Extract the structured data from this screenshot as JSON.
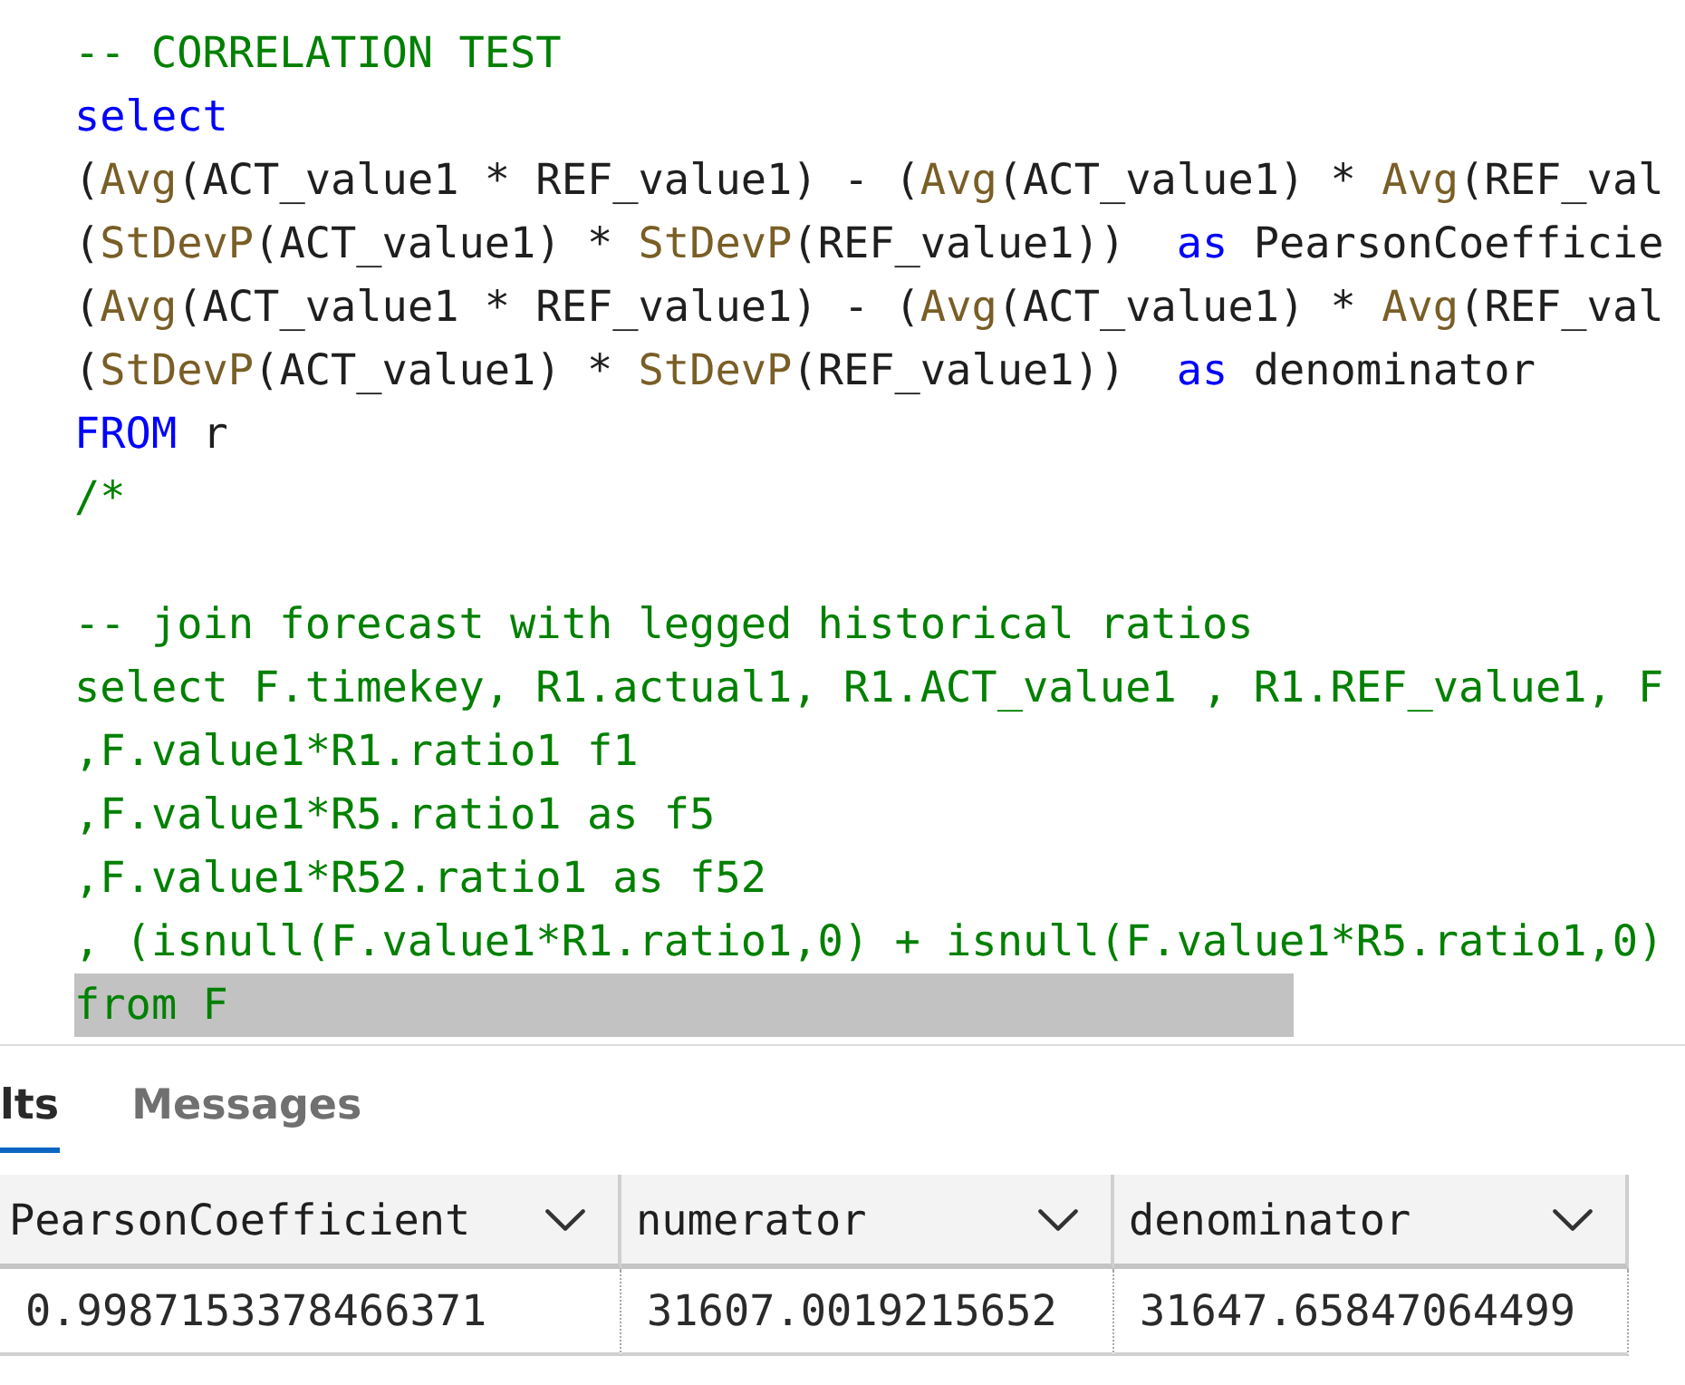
{
  "editor": {
    "lines": [
      {
        "kind": "code",
        "selected": false,
        "tokens": [
          {
            "kind": "comment",
            "text": "-- CORRELATION TEST"
          }
        ]
      },
      {
        "kind": "code",
        "selected": false,
        "tokens": [
          {
            "kind": "keyword",
            "text": "select"
          }
        ]
      },
      {
        "kind": "code",
        "selected": false,
        "tokens": [
          {
            "kind": "plain",
            "text": "("
          },
          {
            "kind": "function",
            "text": "Avg"
          },
          {
            "kind": "plain",
            "text": "(ACT_value1 * REF_value1) - ("
          },
          {
            "kind": "function",
            "text": "Avg"
          },
          {
            "kind": "plain",
            "text": "(ACT_value1) * "
          },
          {
            "kind": "function",
            "text": "Avg"
          },
          {
            "kind": "plain",
            "text": "(REF_val"
          }
        ]
      },
      {
        "kind": "code",
        "selected": false,
        "tokens": [
          {
            "kind": "plain",
            "text": "("
          },
          {
            "kind": "function",
            "text": "StDevP"
          },
          {
            "kind": "plain",
            "text": "(ACT_value1) * "
          },
          {
            "kind": "function",
            "text": "StDevP"
          },
          {
            "kind": "plain",
            "text": "(REF_value1))  "
          },
          {
            "kind": "keyword",
            "text": "as"
          },
          {
            "kind": "plain",
            "text": " PearsonCoefficie"
          }
        ]
      },
      {
        "kind": "code",
        "selected": false,
        "tokens": [
          {
            "kind": "plain",
            "text": "("
          },
          {
            "kind": "function",
            "text": "Avg"
          },
          {
            "kind": "plain",
            "text": "(ACT_value1 * REF_value1) - ("
          },
          {
            "kind": "function",
            "text": "Avg"
          },
          {
            "kind": "plain",
            "text": "(ACT_value1) * "
          },
          {
            "kind": "function",
            "text": "Avg"
          },
          {
            "kind": "plain",
            "text": "(REF_val"
          }
        ]
      },
      {
        "kind": "code",
        "selected": false,
        "tokens": [
          {
            "kind": "plain",
            "text": "("
          },
          {
            "kind": "function",
            "text": "StDevP"
          },
          {
            "kind": "plain",
            "text": "(ACT_value1) * "
          },
          {
            "kind": "function",
            "text": "StDevP"
          },
          {
            "kind": "plain",
            "text": "(REF_value1))  "
          },
          {
            "kind": "keyword",
            "text": "as"
          },
          {
            "kind": "plain",
            "text": " denominator"
          }
        ]
      },
      {
        "kind": "code",
        "selected": false,
        "tokens": [
          {
            "kind": "keyword",
            "text": "FROM"
          },
          {
            "kind": "plain",
            "text": " r"
          }
        ]
      },
      {
        "kind": "code",
        "selected": false,
        "tokens": [
          {
            "kind": "comment",
            "text": "/*"
          }
        ]
      },
      {
        "kind": "blank"
      },
      {
        "kind": "code",
        "selected": false,
        "tokens": [
          {
            "kind": "comment",
            "text": "-- join forecast with legged historical ratios"
          }
        ]
      },
      {
        "kind": "code",
        "selected": false,
        "tokens": [
          {
            "kind": "comment",
            "text": "select F.timekey, R1.actual1, R1.ACT_value1 , R1.REF_value1, F"
          }
        ]
      },
      {
        "kind": "code",
        "selected": false,
        "tokens": [
          {
            "kind": "comment",
            "text": ",F.value1*R1.ratio1 f1"
          }
        ]
      },
      {
        "kind": "code",
        "selected": false,
        "tokens": [
          {
            "kind": "comment",
            "text": ",F.value1*R5.ratio1 as f5"
          }
        ]
      },
      {
        "kind": "code",
        "selected": false,
        "tokens": [
          {
            "kind": "comment",
            "text": ",F.value1*R52.ratio1 as f52"
          }
        ]
      },
      {
        "kind": "code",
        "selected": false,
        "tokens": [
          {
            "kind": "comment",
            "text": ", (isnull(F.value1*R1.ratio1,0) + isnull(F.value1*R5.ratio1,0)"
          }
        ]
      },
      {
        "kind": "code",
        "selected": true,
        "tokens": [
          {
            "kind": "comment",
            "text": "from F"
          }
        ]
      }
    ]
  },
  "results": {
    "tabs": [
      {
        "label": "lts",
        "selected": true
      },
      {
        "label": "Messages",
        "selected": false
      }
    ],
    "table": {
      "columns": [
        {
          "label": "PearsonCoefficient"
        },
        {
          "label": "numerator"
        },
        {
          "label": "denominator"
        }
      ],
      "rows": [
        [
          "0.9987153378466371",
          "31607.0019215652",
          "31647.65847064499"
        ]
      ]
    }
  }
}
